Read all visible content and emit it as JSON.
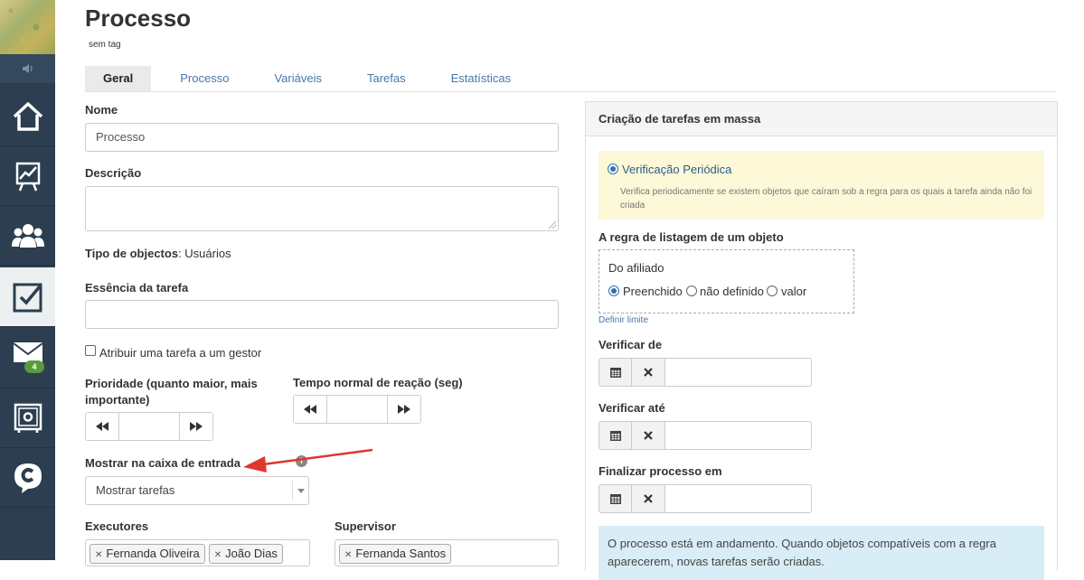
{
  "sidebar": {
    "items": [
      {
        "icon": "home-icon",
        "active": false
      },
      {
        "icon": "chart-icon",
        "active": false
      },
      {
        "icon": "users-icon",
        "active": false
      },
      {
        "icon": "tasks-checkbox-icon",
        "active": true
      },
      {
        "icon": "mail-icon",
        "active": false,
        "badge": "4"
      },
      {
        "icon": "safe-icon",
        "active": false
      },
      {
        "icon": "chat-logo-icon",
        "active": false
      }
    ]
  },
  "header": {
    "title": "Processo",
    "subtitle": "sem tag"
  },
  "tabs": [
    {
      "label": "Geral",
      "active": true
    },
    {
      "label": "Processo",
      "active": false
    },
    {
      "label": "Variáveis",
      "active": false
    },
    {
      "label": "Tarefas",
      "active": false
    },
    {
      "label": "Estatísticas",
      "active": false
    }
  ],
  "form": {
    "name_label": "Nome",
    "name_value": "Processo",
    "description_label": "Descrição",
    "object_type_label": "Tipo de objectos",
    "object_type_value": ": Usuários",
    "task_essence_label": "Essência da tarefa",
    "assign_manager_label": "Atribuir uma tarefa a um gestor",
    "priority_label": "Prioridade (quanto maior, mais importante)",
    "reaction_time_label": "Tempo normal de reação (seg)",
    "inbox_label": "Mostrar na caixa de entrada",
    "inbox_select_value": "Mostrar tarefas",
    "executors_label": "Executores",
    "executors": [
      "Fernanda Oliveira",
      "João Dias"
    ],
    "supervisor_label": "Supervisor",
    "supervisors": [
      "Fernanda Santos"
    ]
  },
  "panel": {
    "title": "Criação de tarefas em massa",
    "periodic_label": "Verificação Periódica",
    "periodic_desc": "Verifica periodicamente se existem objetos que caíram sob a regra para os quais a tarefa ainda não foi criada",
    "rule_label": "A regra de listagem de um objeto",
    "affiliate_label": "Do afiliado",
    "options": [
      "Preenchido",
      "não definido",
      "valor"
    ],
    "limit_link": "Definir limite",
    "check_from_label": "Verificar de",
    "check_until_label": "Verificar até",
    "finish_label": "Finalizar processo em",
    "status_text": "O processo está em andamento. Quando objetos compatíveis com a regra aparecerem, novas tarefas serão criadas."
  },
  "colors": {
    "sidebar_bg": "#2c3e50",
    "link": "#4a76a8",
    "badge": "#5b9a3b",
    "hint_bg": "#fcf8d8",
    "status_bg": "#d9edf7",
    "annotation_arrow": "#e0362c"
  }
}
